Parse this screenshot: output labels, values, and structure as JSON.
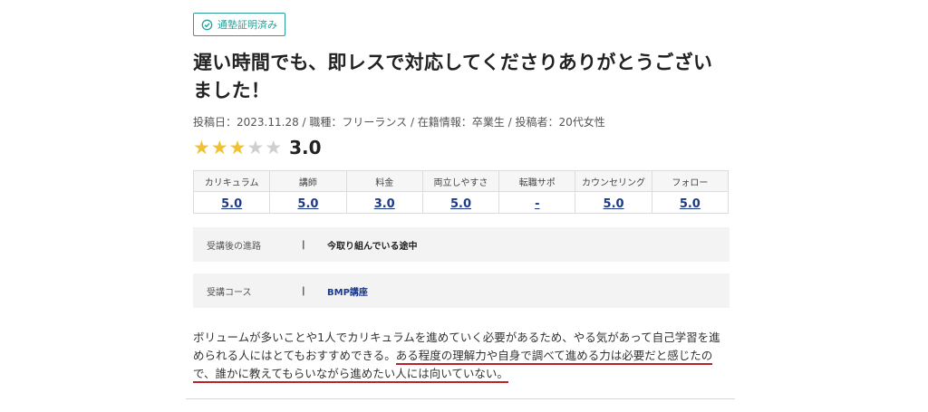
{
  "badge": {
    "label": "通塾証明済み",
    "icon": "check-circle-icon",
    "color": "#2aa198"
  },
  "title": "遅い時間でも、即レスで対応してくださりありがとうございました！",
  "meta": "投稿日：2023.11.28 / 職種：フリーランス / 在籍情報：卒業生 / 投稿者：20代女性",
  "rating": {
    "value": 3,
    "max": 5,
    "score_text": "3.0",
    "on_color": "#f2c12e"
  },
  "score_table": {
    "headers": [
      "カリキュラム",
      "講師",
      "料金",
      "両立しやすさ",
      "転職サポ",
      "カウンセリング",
      "フォロー"
    ],
    "values": [
      "5.0",
      "5.0",
      "3.0",
      "5.0",
      "-",
      "5.0",
      "5.0"
    ]
  },
  "info_rows": [
    {
      "label": "受講後の進路",
      "sep": "|",
      "value": "今取り組んでいる途中"
    },
    {
      "label": "受講コース",
      "sep": "|",
      "value": "BMP講座"
    }
  ],
  "review": {
    "plain": "ボリュームが多いことや1人でカリキュラムを進めていく必要があるため、やる気があって自己学習を進められる人にはとてもおすすめできる。",
    "underlined": "ある程度の理解力や自身で調べて進める力は必要だと感じたので、誰かに教えてもらいながら進めたい人には向いていない。",
    "underline_color": "#c0202a"
  }
}
